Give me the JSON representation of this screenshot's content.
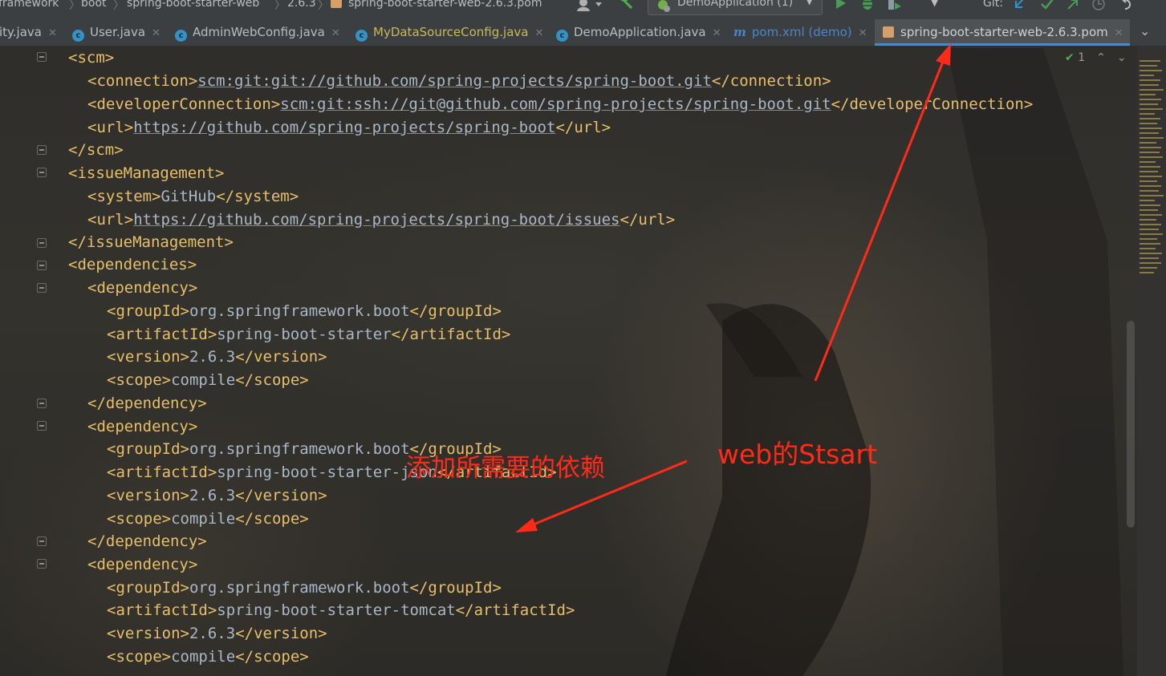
{
  "breadcrumbs": [
    "framework",
    "boot",
    "spring-boot-starter-web",
    "2.6.3",
    "spring-boot-starter-web-2.6.3.pom"
  ],
  "run_config": "DemoApplication (1)",
  "git_label": "Git:",
  "tabs": [
    {
      "label": "ity.java"
    },
    {
      "label": "User.java"
    },
    {
      "label": "AdminWebConfig.java"
    },
    {
      "label": "MyDataSourceConfig.java"
    },
    {
      "label": "DemoApplication.java"
    },
    {
      "label": "pom.xml (demo)"
    },
    {
      "label": "spring-boot-starter-web-2.6.3.pom"
    }
  ],
  "problems_count": "1",
  "code": {
    "scm": "scm",
    "connection": "connection",
    "connection_value": "scm:git:git://github.com/spring-projects/spring-boot.git",
    "developer_connection": "developerConnection",
    "developer_connection_value": "scm:git:ssh://git@github.com/spring-projects/spring-boot.git",
    "url": "url",
    "scm_url_value": "https://github.com/spring-projects/spring-boot",
    "issue_management": "issueManagement",
    "system": "system",
    "system_value": "GitHub",
    "issues_url_value": "https://github.com/spring-projects/spring-boot/issues",
    "dependencies": "dependencies",
    "dependency": "dependency",
    "group_id": "groupId",
    "artifact_id": "artifactId",
    "version": "version",
    "scope": "scope",
    "deps": [
      {
        "group": "org.springframework.boot",
        "artifact": "spring-boot-starter",
        "version": "2.6.3",
        "scope": "compile"
      },
      {
        "group": "org.springframework.boot",
        "artifact": "spring-boot-starter-json",
        "version": "2.6.3",
        "scope": "compile"
      },
      {
        "group": "org.springframework.boot",
        "artifact": "spring-boot-starter-tomcat",
        "version": "2.6.3",
        "scope": "compile"
      }
    ]
  },
  "annotations": {
    "web_start": "web的Stsart",
    "add_deps": "添加所需要的依赖"
  },
  "colors": {
    "tag": "#e8bf6a",
    "text": "#a9b7c6",
    "annotation": "#ff2a1a",
    "active_tab_underline": "#4a88c7"
  }
}
